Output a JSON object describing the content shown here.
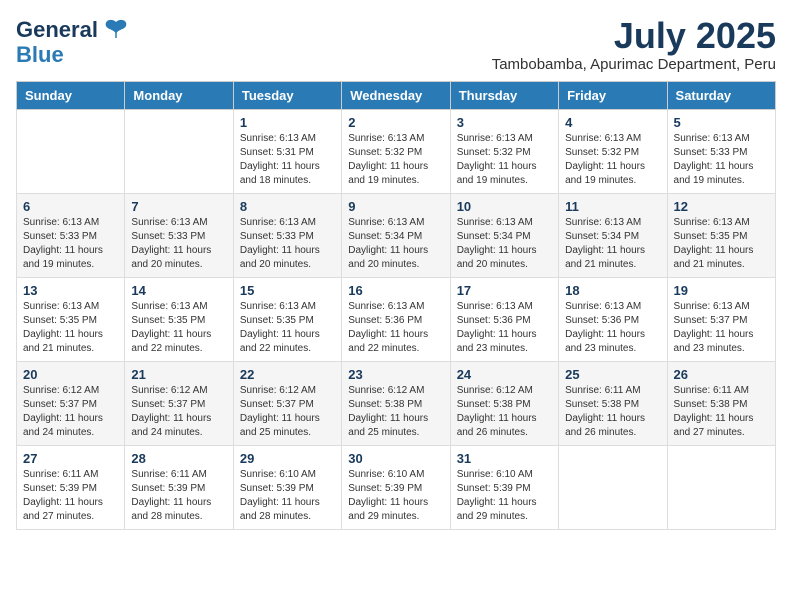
{
  "header": {
    "logo_general": "General",
    "logo_blue": "Blue",
    "month_title": "July 2025",
    "subtitle": "Tambobamba, Apurimac Department, Peru"
  },
  "days_of_week": [
    "Sunday",
    "Monday",
    "Tuesday",
    "Wednesday",
    "Thursday",
    "Friday",
    "Saturday"
  ],
  "weeks": [
    [
      {
        "day": "",
        "info": ""
      },
      {
        "day": "",
        "info": ""
      },
      {
        "day": "1",
        "info": "Sunrise: 6:13 AM\nSunset: 5:31 PM\nDaylight: 11 hours and 18 minutes."
      },
      {
        "day": "2",
        "info": "Sunrise: 6:13 AM\nSunset: 5:32 PM\nDaylight: 11 hours and 19 minutes."
      },
      {
        "day": "3",
        "info": "Sunrise: 6:13 AM\nSunset: 5:32 PM\nDaylight: 11 hours and 19 minutes."
      },
      {
        "day": "4",
        "info": "Sunrise: 6:13 AM\nSunset: 5:32 PM\nDaylight: 11 hours and 19 minutes."
      },
      {
        "day": "5",
        "info": "Sunrise: 6:13 AM\nSunset: 5:33 PM\nDaylight: 11 hours and 19 minutes."
      }
    ],
    [
      {
        "day": "6",
        "info": "Sunrise: 6:13 AM\nSunset: 5:33 PM\nDaylight: 11 hours and 19 minutes."
      },
      {
        "day": "7",
        "info": "Sunrise: 6:13 AM\nSunset: 5:33 PM\nDaylight: 11 hours and 20 minutes."
      },
      {
        "day": "8",
        "info": "Sunrise: 6:13 AM\nSunset: 5:33 PM\nDaylight: 11 hours and 20 minutes."
      },
      {
        "day": "9",
        "info": "Sunrise: 6:13 AM\nSunset: 5:34 PM\nDaylight: 11 hours and 20 minutes."
      },
      {
        "day": "10",
        "info": "Sunrise: 6:13 AM\nSunset: 5:34 PM\nDaylight: 11 hours and 20 minutes."
      },
      {
        "day": "11",
        "info": "Sunrise: 6:13 AM\nSunset: 5:34 PM\nDaylight: 11 hours and 21 minutes."
      },
      {
        "day": "12",
        "info": "Sunrise: 6:13 AM\nSunset: 5:35 PM\nDaylight: 11 hours and 21 minutes."
      }
    ],
    [
      {
        "day": "13",
        "info": "Sunrise: 6:13 AM\nSunset: 5:35 PM\nDaylight: 11 hours and 21 minutes."
      },
      {
        "day": "14",
        "info": "Sunrise: 6:13 AM\nSunset: 5:35 PM\nDaylight: 11 hours and 22 minutes."
      },
      {
        "day": "15",
        "info": "Sunrise: 6:13 AM\nSunset: 5:35 PM\nDaylight: 11 hours and 22 minutes."
      },
      {
        "day": "16",
        "info": "Sunrise: 6:13 AM\nSunset: 5:36 PM\nDaylight: 11 hours and 22 minutes."
      },
      {
        "day": "17",
        "info": "Sunrise: 6:13 AM\nSunset: 5:36 PM\nDaylight: 11 hours and 23 minutes."
      },
      {
        "day": "18",
        "info": "Sunrise: 6:13 AM\nSunset: 5:36 PM\nDaylight: 11 hours and 23 minutes."
      },
      {
        "day": "19",
        "info": "Sunrise: 6:13 AM\nSunset: 5:37 PM\nDaylight: 11 hours and 23 minutes."
      }
    ],
    [
      {
        "day": "20",
        "info": "Sunrise: 6:12 AM\nSunset: 5:37 PM\nDaylight: 11 hours and 24 minutes."
      },
      {
        "day": "21",
        "info": "Sunrise: 6:12 AM\nSunset: 5:37 PM\nDaylight: 11 hours and 24 minutes."
      },
      {
        "day": "22",
        "info": "Sunrise: 6:12 AM\nSunset: 5:37 PM\nDaylight: 11 hours and 25 minutes."
      },
      {
        "day": "23",
        "info": "Sunrise: 6:12 AM\nSunset: 5:38 PM\nDaylight: 11 hours and 25 minutes."
      },
      {
        "day": "24",
        "info": "Sunrise: 6:12 AM\nSunset: 5:38 PM\nDaylight: 11 hours and 26 minutes."
      },
      {
        "day": "25",
        "info": "Sunrise: 6:11 AM\nSunset: 5:38 PM\nDaylight: 11 hours and 26 minutes."
      },
      {
        "day": "26",
        "info": "Sunrise: 6:11 AM\nSunset: 5:38 PM\nDaylight: 11 hours and 27 minutes."
      }
    ],
    [
      {
        "day": "27",
        "info": "Sunrise: 6:11 AM\nSunset: 5:39 PM\nDaylight: 11 hours and 27 minutes."
      },
      {
        "day": "28",
        "info": "Sunrise: 6:11 AM\nSunset: 5:39 PM\nDaylight: 11 hours and 28 minutes."
      },
      {
        "day": "29",
        "info": "Sunrise: 6:10 AM\nSunset: 5:39 PM\nDaylight: 11 hours and 28 minutes."
      },
      {
        "day": "30",
        "info": "Sunrise: 6:10 AM\nSunset: 5:39 PM\nDaylight: 11 hours and 29 minutes."
      },
      {
        "day": "31",
        "info": "Sunrise: 6:10 AM\nSunset: 5:39 PM\nDaylight: 11 hours and 29 minutes."
      },
      {
        "day": "",
        "info": ""
      },
      {
        "day": "",
        "info": ""
      }
    ]
  ]
}
